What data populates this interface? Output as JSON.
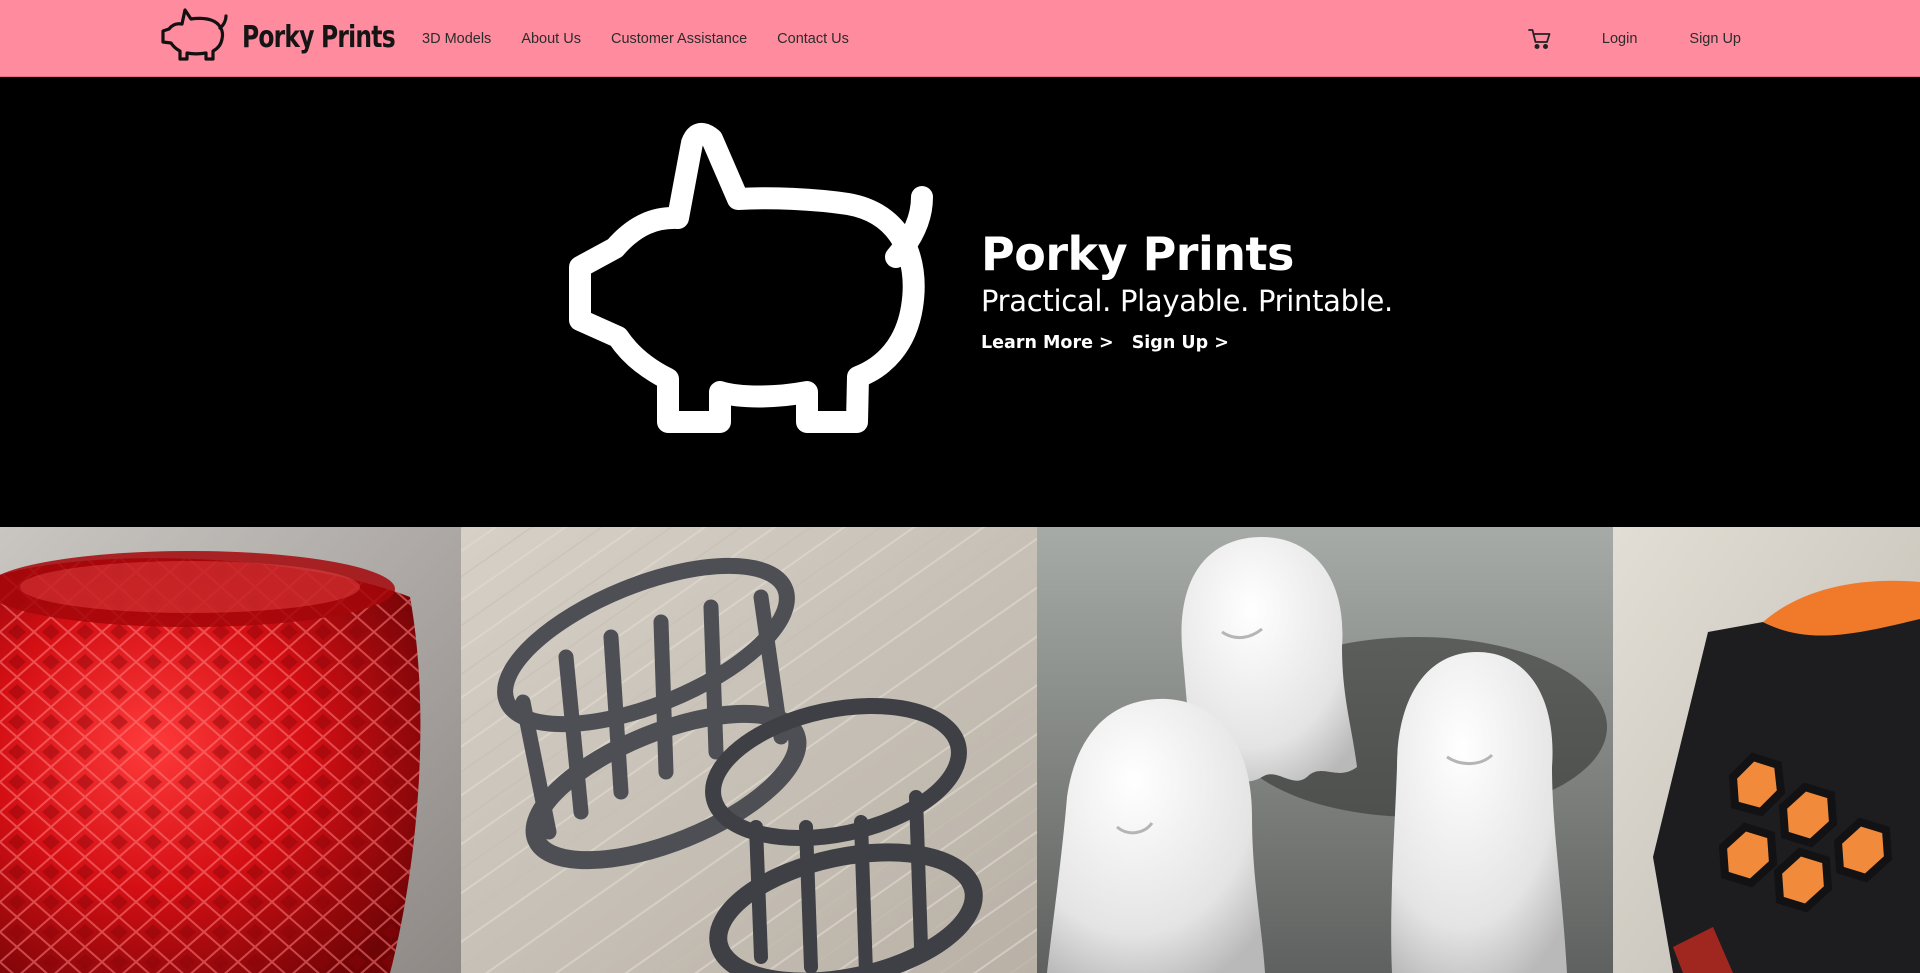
{
  "brand": {
    "name": "Porky Prints",
    "logo_icon": "pig-outline-icon"
  },
  "nav": {
    "links": [
      {
        "label": "3D Models"
      },
      {
        "label": "About Us"
      },
      {
        "label": "Customer Assistance"
      },
      {
        "label": "Contact Us"
      }
    ],
    "cart_icon": "shopping-cart-icon",
    "login_label": "Login",
    "signup_label": "Sign Up"
  },
  "hero": {
    "title": "Porky Prints",
    "tagline": "Practical. Playable. Printable.",
    "learn_more_label": "Learn More >",
    "sign_up_label": "Sign Up >",
    "pig_icon": "pig-outline-icon"
  },
  "gallery": {
    "tiles": [
      {
        "subject": "red-geometric-vase"
      },
      {
        "subject": "gray-lattice-rings"
      },
      {
        "subject": "white-ghost-figurines"
      },
      {
        "subject": "black-hexagon-box"
      }
    ]
  },
  "colors": {
    "nav_background": "#ff8b9e",
    "hero_background": "#000000",
    "hero_text": "#ffffff",
    "nav_text": "#2c2c2c"
  }
}
